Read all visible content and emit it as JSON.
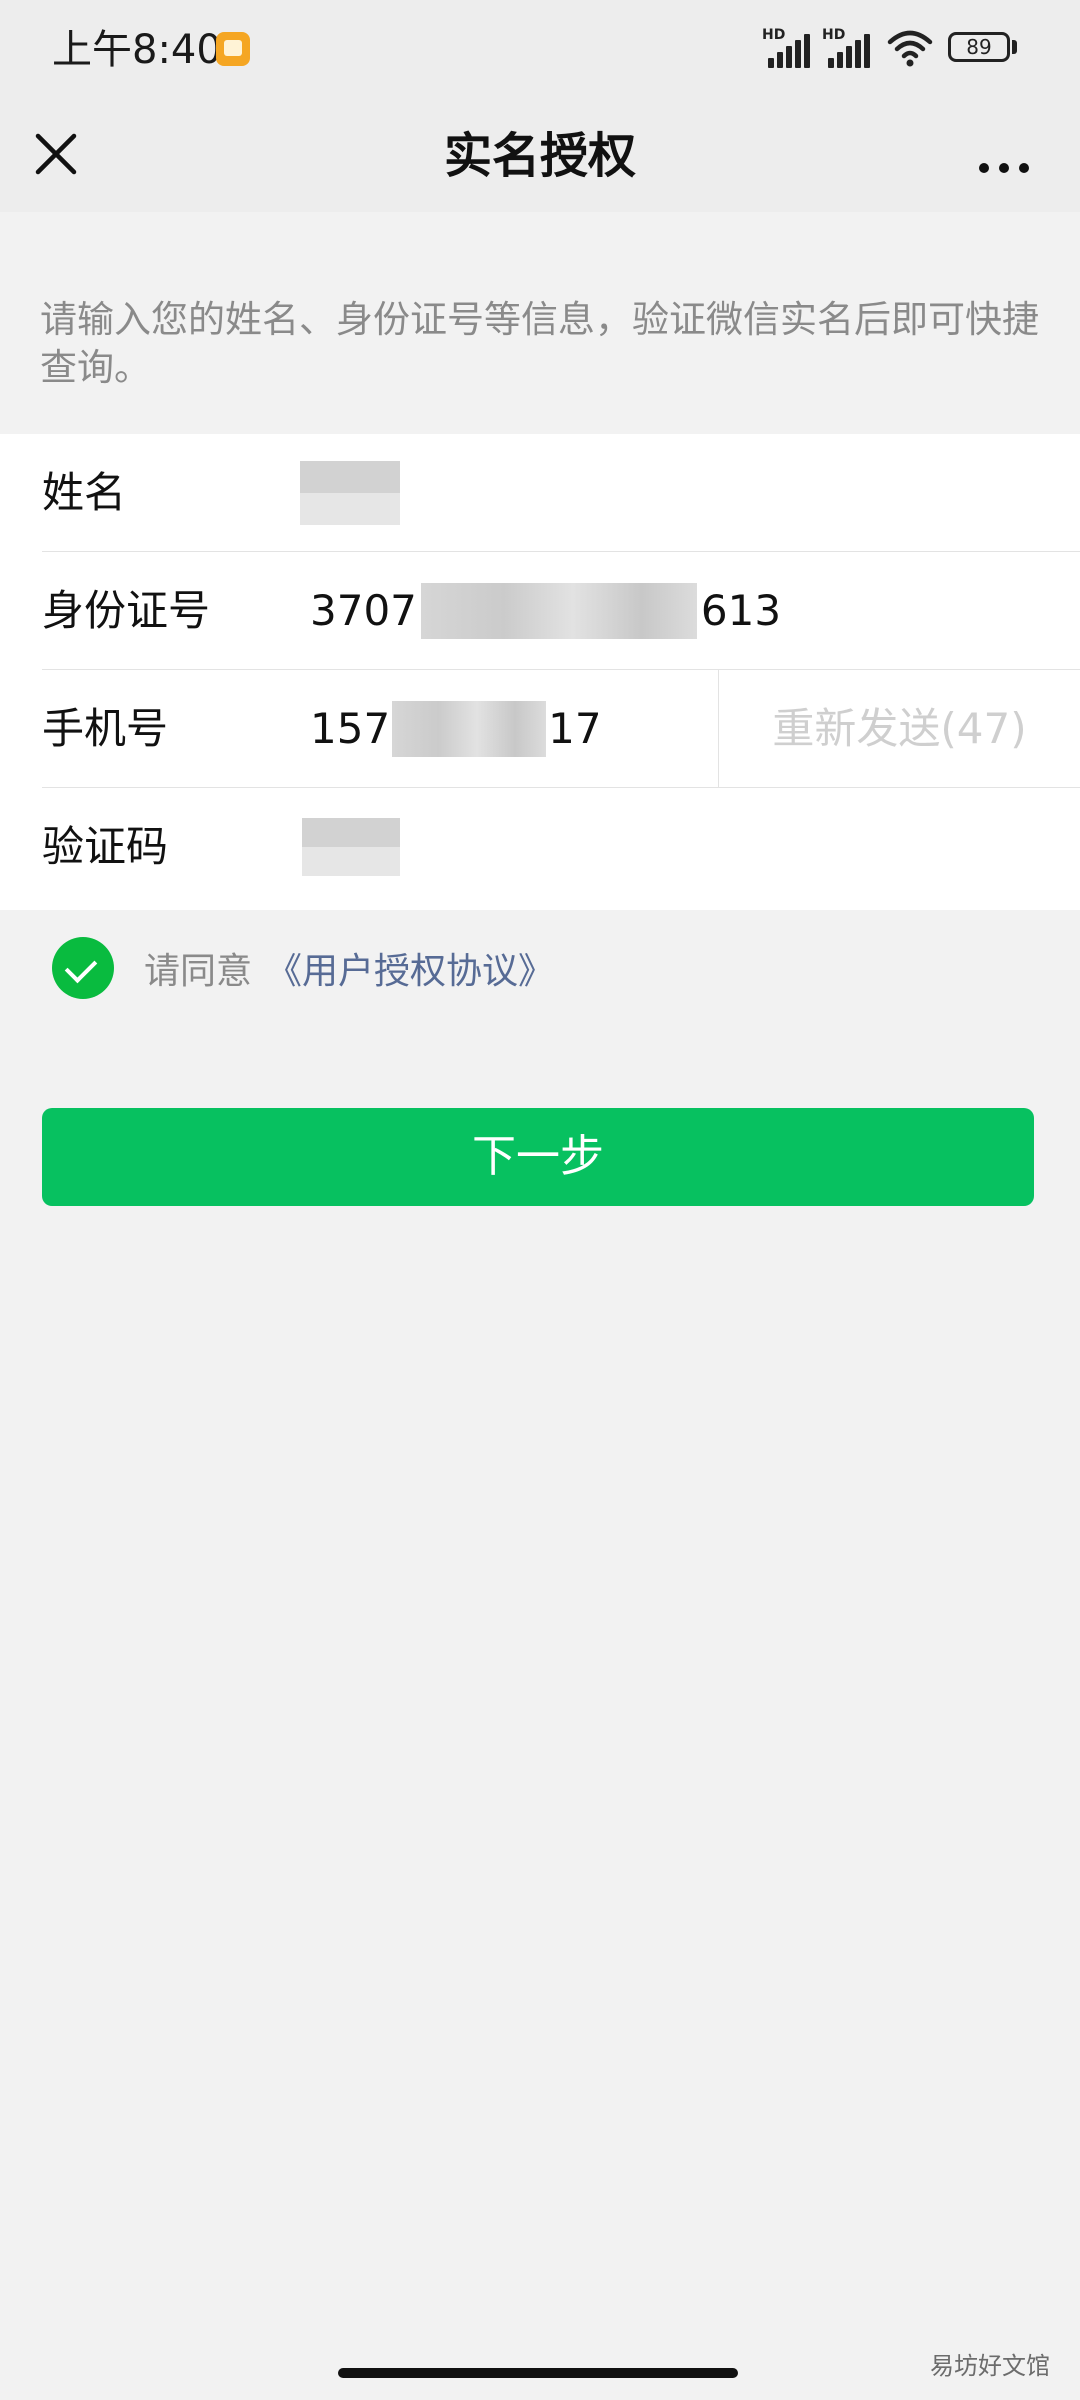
{
  "status_bar": {
    "time": "上午8:40",
    "network_1": "HD",
    "network_2": "HD",
    "battery": "89"
  },
  "nav": {
    "title": "实名授权",
    "close_icon": "close-icon",
    "more_icon": "more-dots-icon"
  },
  "intro_text": "请输入您的姓名、身份证号等信息，验证微信实名后即可快捷查询。",
  "form": {
    "rows": [
      {
        "label": "姓名",
        "value_prefix": "",
        "value_suffix": ""
      },
      {
        "label": "身份证号",
        "value_prefix": "3707",
        "value_suffix": "613"
      },
      {
        "label": "手机号",
        "value_prefix": "157",
        "value_suffix": "17"
      },
      {
        "label": "验证码",
        "value_prefix": "",
        "value_suffix": ""
      }
    ],
    "resend_label": "重新发送(47)"
  },
  "agreement": {
    "checked": true,
    "prefix": "请同意",
    "link": "《用户授权协议》"
  },
  "next_button": "下一步",
  "watermark": "易坊好文馆",
  "colors": {
    "primary_green": "#07c160",
    "link_blue": "#576b95",
    "check_green": "#09bb3f"
  }
}
